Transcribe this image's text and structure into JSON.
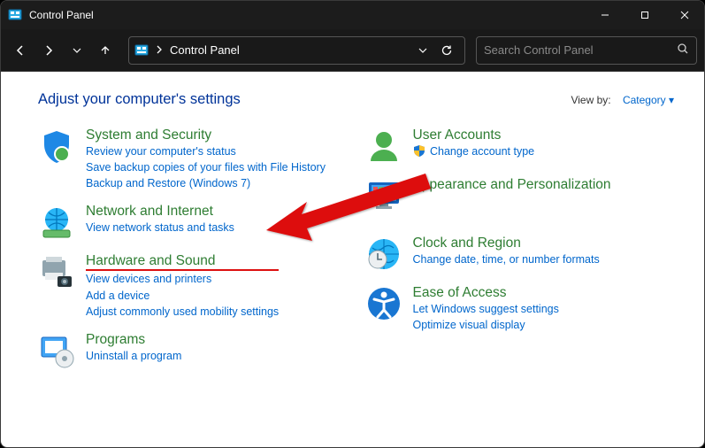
{
  "window": {
    "title": "Control Panel"
  },
  "toolbar": {
    "breadcrumb": "Control Panel"
  },
  "search": {
    "placeholder": "Search Control Panel"
  },
  "header": {
    "title": "Adjust your computer's settings",
    "view_by_label": "View by:",
    "view_by_value": "Category"
  },
  "columns": {
    "left": [
      {
        "id": "system-security",
        "title": "System and Security",
        "links": [
          "Review your computer's status",
          "Save backup copies of your files with File History",
          "Backup and Restore (Windows 7)"
        ]
      },
      {
        "id": "network-internet",
        "title": "Network and Internet",
        "links": [
          "View network status and tasks"
        ]
      },
      {
        "id": "hardware-sound",
        "title": "Hardware and Sound",
        "links": [
          "View devices and printers",
          "Add a device",
          "Adjust commonly used mobility settings"
        ]
      },
      {
        "id": "programs",
        "title": "Programs",
        "links": [
          "Uninstall a program"
        ]
      }
    ],
    "right": [
      {
        "id": "user-accounts",
        "title": "User Accounts",
        "links": [
          "Change account type"
        ],
        "shield": [
          true
        ]
      },
      {
        "id": "appearance",
        "title": "Appearance and Personalization",
        "links": []
      },
      {
        "id": "clock-region",
        "title": "Clock and Region",
        "links": [
          "Change date, time, or number formats"
        ]
      },
      {
        "id": "ease-access",
        "title": "Ease of Access",
        "links": [
          "Let Windows suggest settings",
          "Optimize visual display"
        ]
      }
    ]
  },
  "annotation": {
    "target_category": "hardware-sound"
  },
  "colors": {
    "heading_blue": "#003399",
    "category_green": "#2e7d32",
    "link_blue": "#0066cc",
    "arrow_red": "#d11"
  }
}
